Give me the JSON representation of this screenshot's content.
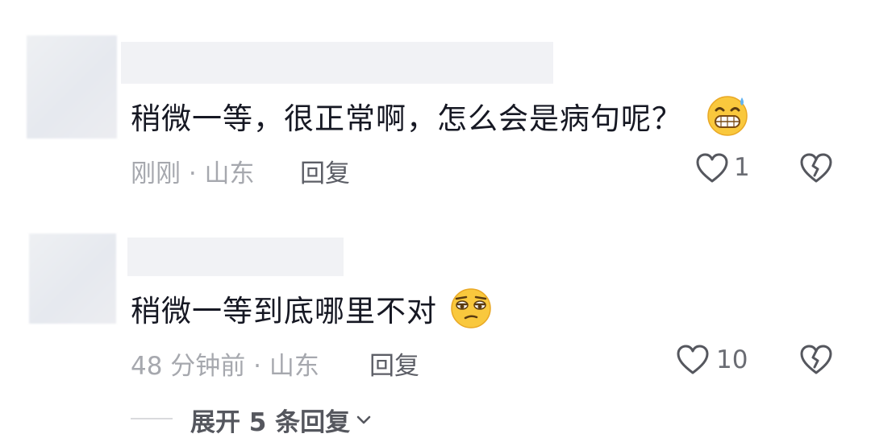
{
  "comments": [
    {
      "text": "稍微一等，很正常啊，怎么会是病句呢？",
      "emoji": "grinning-sweat-emoji",
      "meta": "刚刚 · 山东",
      "reply_label": "回复",
      "likes": "1"
    },
    {
      "text": "稍微一等到底哪里不对",
      "emoji": "unamused-eye-roll-emoji",
      "meta": "48 分钟前 · 山东",
      "reply_label": "回复",
      "likes": "10"
    }
  ],
  "expand_replies": {
    "label": "展开 5 条回复",
    "icon": "chevron-down-icon"
  },
  "colors": {
    "text": "#161823",
    "meta": "#a6a8ae",
    "icon": "#55575e"
  }
}
